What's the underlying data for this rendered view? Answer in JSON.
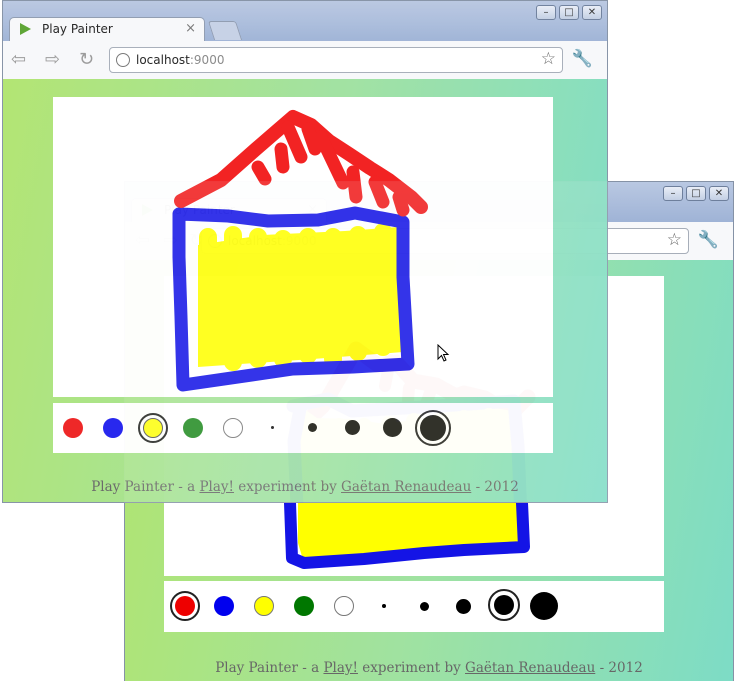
{
  "browser": {
    "tab_title": "Play Painter",
    "tab_close": "×",
    "url_host": "localhost",
    "url_port": ":9000",
    "window_buttons": {
      "minimize": "–",
      "maximize": "□",
      "close": "✕"
    }
  },
  "footer": {
    "prefix": "Play Painter - a ",
    "play_link": "Play!",
    "middle": " experiment by ",
    "author_link": "Gaëtan Renaudeau",
    "suffix": " - 2012"
  },
  "front_palette": {
    "colors": [
      "#ee2222",
      "#2222ee",
      "#ffff11",
      "#228b22",
      "#ffffff"
    ],
    "selected_color_index": 2,
    "brush_sizes": [
      1.5,
      4,
      7,
      9.5,
      12.5
    ],
    "selected_size_index": 4
  },
  "back_palette": {
    "colors": [
      "#ee0000",
      "#0000ee",
      "#ffff00",
      "#007700",
      "#ffffff"
    ],
    "selected_color_index": 0,
    "brush_sizes": [
      1.5,
      3.5,
      7,
      10.5,
      13.5
    ],
    "selected_size_index": 3
  },
  "colors": {
    "red": "#f21c1c",
    "blue": "#1414e6",
    "yellow": "#ffff00"
  }
}
